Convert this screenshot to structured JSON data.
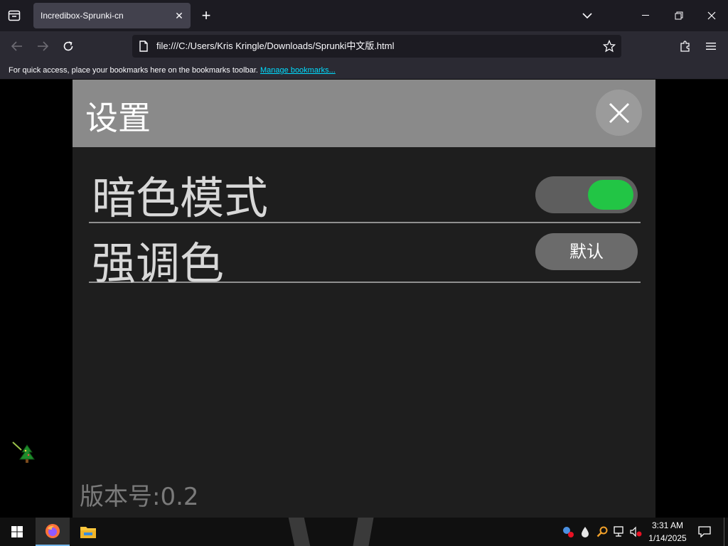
{
  "browser": {
    "tab_title": "Incredibox-Sprunki-cn",
    "tab_close": "✕",
    "new_tab": "+",
    "url": "file:///C:/Users/Kris Kringle/Downloads/Sprunki中文版.html",
    "bookmarks_text": "For quick access, place your bookmarks here on the bookmarks toolbar.",
    "bookmarks_link": "Manage bookmarks..."
  },
  "settings": {
    "title": "设置",
    "rows": [
      {
        "label": "暗色模式",
        "control": "toggle",
        "toggle_on": true
      },
      {
        "label": "强调色",
        "control": "button",
        "button_label": "默认"
      }
    ],
    "version": "版本号:0.2"
  },
  "taskbar": {
    "time": "3:31 AM",
    "date": "1/14/2025"
  },
  "colors": {
    "accent_toggle": "#22c545",
    "panel_header": "#8a8a8a",
    "panel_bg": "#1e1e1e",
    "link": "#00ddff"
  }
}
